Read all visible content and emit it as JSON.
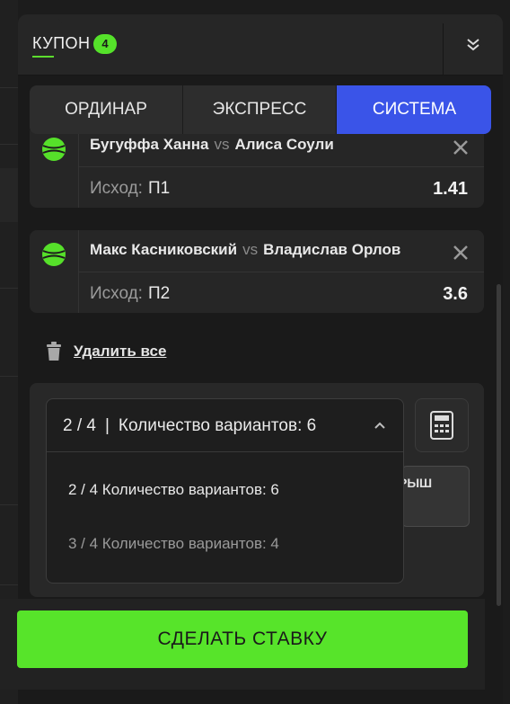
{
  "coupon": {
    "title": "Купон",
    "count": "4"
  },
  "tabs": [
    {
      "label": "Ординар",
      "active": false
    },
    {
      "label": "Экспресс",
      "active": false
    },
    {
      "label": "Система",
      "active": true
    }
  ],
  "bets": [
    {
      "player1": "Бугуффа Ханна",
      "vs": "vs",
      "player2": "Алиса Соули",
      "outcome_label": "Исход:",
      "outcome": "П1",
      "odds": "1.41",
      "sport_icon": "tennis-ball-icon"
    },
    {
      "player1": "Макс Касниковский",
      "vs": "vs",
      "player2": "Владислав Орлов",
      "outcome_label": "Исход:",
      "outcome": "П2",
      "odds": "3.6",
      "sport_icon": "tennis-ball-icon"
    }
  ],
  "delete_all": {
    "label": "Удалить все",
    "icon": "trash-icon"
  },
  "system": {
    "selected_ratio": "2 / 4",
    "selected_separator": "|",
    "selected_variants": "Количество вариантов: 6",
    "options": [
      {
        "label": "2 / 4 Количество вариантов: 6",
        "selected": true
      },
      {
        "label": "3 / 4 Количество вариантов: 4",
        "selected": false
      }
    ],
    "partially_hidden_label": "РЫШ"
  },
  "submit": {
    "label": "Сделать ставку"
  },
  "colors": {
    "accent_green": "#57e42a",
    "active_tab_blue": "#3a54e8",
    "panel_bg": "#1a1a1a",
    "card_bg": "#262626"
  }
}
